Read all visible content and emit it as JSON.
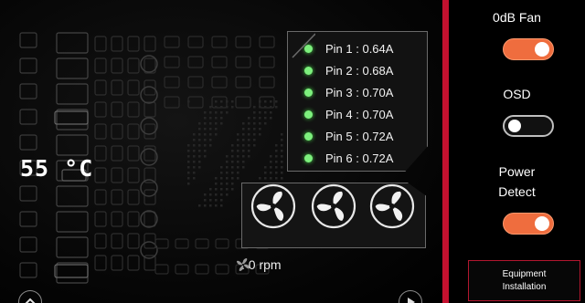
{
  "temperature": {
    "value": "55",
    "unit": "°C"
  },
  "pins": [
    {
      "label": "Pin 1 : 0.64A"
    },
    {
      "label": "Pin 2 : 0.68A"
    },
    {
      "label": "Pin 3 : 0.70A"
    },
    {
      "label": "Pin 4 : 0.70A"
    },
    {
      "label": "Pin 5 : 0.72A"
    },
    {
      "label": "Pin 6 : 0.72A"
    }
  ],
  "fans": {
    "count": 3,
    "rpm_text": ": 0 rpm"
  },
  "settings": {
    "zero_db_fan": {
      "label": "0dB Fan",
      "enabled": true
    },
    "osd": {
      "label": "OSD",
      "enabled": false
    },
    "power_detect": {
      "label_line1": "Power",
      "label_line2": "Detect",
      "enabled": true
    },
    "equipment_button": {
      "line1": "Equipment",
      "line2": "Installation"
    }
  },
  "colors": {
    "accent_red": "#c4112f",
    "toggle_on": "#ef6d3e",
    "pin_status": "#7df07d"
  },
  "icons": {
    "fan": "fan-icon",
    "rpm": "fan-small-icon",
    "scroll_up": "chevron-up-icon",
    "scroll_next": "chevron-right-icon"
  }
}
